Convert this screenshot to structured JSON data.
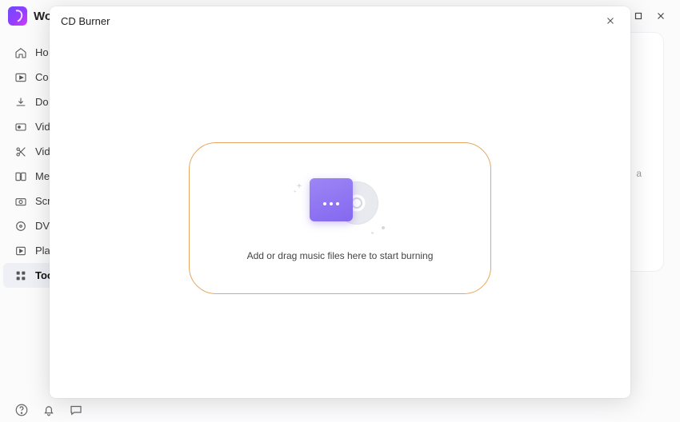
{
  "app": {
    "name": "Wo"
  },
  "sidebar": {
    "items": [
      {
        "label": "Ho"
      },
      {
        "label": "Co"
      },
      {
        "label": "Do"
      },
      {
        "label": "Vid"
      },
      {
        "label": "Vid"
      },
      {
        "label": "Me"
      },
      {
        "label": "Scre"
      },
      {
        "label": "DVI"
      },
      {
        "label": "Play"
      },
      {
        "label": "Too"
      }
    ]
  },
  "background": {
    "label": "a"
  },
  "dialog": {
    "title": "CD Burner",
    "dropText": "Add or drag music files here to start burning"
  }
}
